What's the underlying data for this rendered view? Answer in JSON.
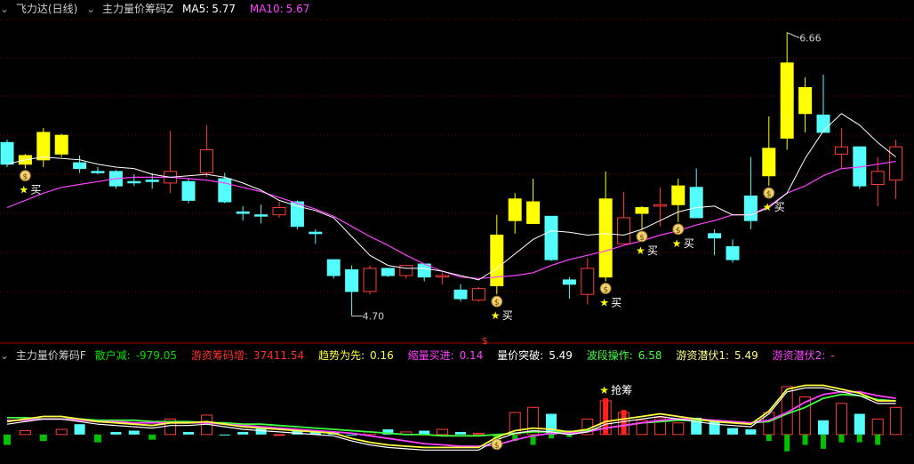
{
  "top_header": {
    "title": "飞力达(日线)",
    "indicator": "主力量价筹码Z",
    "ma5_label": "MA5:",
    "ma5_value": "5.77",
    "ma10_label": "MA10:",
    "ma10_value": "5.67"
  },
  "sub_header": {
    "indicator": "主力量价筹码F",
    "items": [
      {
        "label": "散户减:",
        "value": "-979.05"
      },
      {
        "label": "游资筹码增:",
        "value": "37411.54"
      },
      {
        "label": "趋势为先:",
        "value": "0.16"
      },
      {
        "label": "缩量买进:",
        "value": "0.14"
      },
      {
        "label": "量价突破:",
        "value": "5.49"
      },
      {
        "label": "波段操作:",
        "value": "6.58"
      },
      {
        "label": "游资潜伏1:",
        "value": "5.49"
      },
      {
        "label": "游资潜伏2:",
        "value": "-"
      }
    ]
  },
  "colors": {
    "up": "#ff3c3c",
    "down": "#54fcfc",
    "signal": "#ffff00",
    "ma5": "#ffffff",
    "ma10": "#ff40ff",
    "grid": "#7a0000",
    "header_ma5": "#ffffff",
    "header_ma10": "#ff40ff"
  },
  "annotations": {
    "high_label": "6.66",
    "low_label": "4.70",
    "buy_label": "买",
    "grab_label": "抢筹",
    "dollar": "$"
  },
  "chart_data": [
    {
      "type": "candlestick",
      "ylim": [
        4.55,
        6.75
      ],
      "candles": [
        {
          "o": 5.9,
          "h": 5.92,
          "c": 5.75,
          "l": 5.73,
          "k": "d"
        },
        {
          "o": 5.75,
          "h": 5.82,
          "c": 5.81,
          "l": 5.72,
          "k": "y"
        },
        {
          "o": 5.78,
          "h": 6.0,
          "c": 5.97,
          "l": 5.73,
          "k": "y"
        },
        {
          "o": 5.82,
          "h": 5.96,
          "c": 5.95,
          "l": 5.8,
          "k": "y"
        },
        {
          "o": 5.76,
          "h": 5.81,
          "c": 5.72,
          "l": 5.69,
          "k": "d"
        },
        {
          "o": 5.7,
          "h": 5.73,
          "c": 5.7,
          "l": 5.68,
          "k": "d"
        },
        {
          "o": 5.7,
          "h": 5.71,
          "c": 5.6,
          "l": 5.58,
          "k": "d"
        },
        {
          "o": 5.63,
          "h": 5.68,
          "c": 5.63,
          "l": 5.6,
          "k": "d"
        },
        {
          "o": 5.64,
          "h": 5.69,
          "c": 5.63,
          "l": 5.58,
          "k": "d"
        },
        {
          "o": 5.62,
          "h": 5.98,
          "c": 5.7,
          "l": 5.55,
          "k": "u"
        },
        {
          "o": 5.63,
          "h": 5.65,
          "c": 5.5,
          "l": 5.48,
          "k": "d"
        },
        {
          "o": 5.69,
          "h": 6.02,
          "c": 5.85,
          "l": 5.66,
          "k": "u"
        },
        {
          "o": 5.65,
          "h": 5.69,
          "c": 5.49,
          "l": 5.48,
          "k": "d"
        },
        {
          "o": 5.42,
          "h": 5.46,
          "c": 5.41,
          "l": 5.36,
          "k": "d"
        },
        {
          "o": 5.4,
          "h": 5.47,
          "c": 5.4,
          "l": 5.34,
          "k": "d"
        },
        {
          "o": 5.4,
          "h": 5.49,
          "c": 5.45,
          "l": 5.38,
          "k": "u"
        },
        {
          "o": 5.49,
          "h": 5.5,
          "c": 5.32,
          "l": 5.3,
          "k": "d"
        },
        {
          "o": 5.28,
          "h": 5.3,
          "c": 5.27,
          "l": 5.2,
          "k": "d"
        },
        {
          "o": 5.09,
          "h": 5.09,
          "c": 4.98,
          "l": 4.96,
          "k": "d"
        },
        {
          "o": 5.02,
          "h": 5.05,
          "c": 4.87,
          "l": 4.7,
          "k": "d"
        },
        {
          "o": 4.87,
          "h": 5.05,
          "c": 5.03,
          "l": 4.85,
          "k": "u"
        },
        {
          "o": 5.03,
          "h": 5.03,
          "c": 4.98,
          "l": 4.97,
          "k": "d"
        },
        {
          "o": 4.98,
          "h": 5.05,
          "c": 5.05,
          "l": 4.96,
          "k": "u"
        },
        {
          "o": 5.06,
          "h": 5.06,
          "c": 4.97,
          "l": 4.94,
          "k": "d"
        },
        {
          "o": 4.98,
          "h": 5.0,
          "c": 4.97,
          "l": 4.92,
          "k": "u"
        },
        {
          "o": 4.88,
          "h": 4.92,
          "c": 4.82,
          "l": 4.8,
          "k": "d"
        },
        {
          "o": 4.81,
          "h": 4.9,
          "c": 4.89,
          "l": 4.8,
          "k": "u"
        },
        {
          "o": 4.91,
          "h": 5.4,
          "c": 5.26,
          "l": 4.85,
          "k": "y"
        },
        {
          "o": 5.36,
          "h": 5.55,
          "c": 5.51,
          "l": 5.27,
          "k": "y"
        },
        {
          "o": 5.49,
          "h": 5.65,
          "c": 5.34,
          "l": 5.34,
          "k": "y"
        },
        {
          "o": 5.39,
          "h": 5.39,
          "c": 5.09,
          "l": 5.08,
          "k": "d"
        },
        {
          "o": 4.95,
          "h": 4.97,
          "c": 4.92,
          "l": 4.82,
          "k": "d"
        },
        {
          "o": 4.85,
          "h": 5.1,
          "c": 5.03,
          "l": 4.78,
          "k": "u"
        },
        {
          "o": 4.97,
          "h": 5.7,
          "c": 5.51,
          "l": 4.94,
          "k": "y"
        },
        {
          "o": 5.38,
          "h": 5.56,
          "c": 5.2,
          "l": 5.2,
          "k": "u"
        },
        {
          "o": 5.41,
          "h": 5.46,
          "c": 5.45,
          "l": 5.3,
          "k": "y"
        },
        {
          "o": 5.46,
          "h": 5.59,
          "c": 5.47,
          "l": 5.32,
          "k": "u"
        },
        {
          "o": 5.6,
          "h": 5.65,
          "c": 5.47,
          "l": 5.35,
          "k": "y"
        },
        {
          "o": 5.59,
          "h": 5.72,
          "c": 5.38,
          "l": 5.38,
          "k": "d"
        },
        {
          "o": 5.27,
          "h": 5.3,
          "c": 5.24,
          "l": 5.12,
          "k": "d"
        },
        {
          "o": 5.18,
          "h": 5.23,
          "c": 5.09,
          "l": 5.07,
          "k": "d"
        },
        {
          "o": 5.36,
          "h": 5.8,
          "c": 5.53,
          "l": 5.3,
          "k": "d"
        },
        {
          "o": 5.67,
          "h": 6.08,
          "c": 5.86,
          "l": 5.6,
          "k": "y"
        },
        {
          "o": 5.93,
          "h": 6.66,
          "c": 6.45,
          "l": 5.85,
          "k": "y"
        },
        {
          "o": 6.28,
          "h": 6.35,
          "c": 6.1,
          "l": 5.97,
          "k": "y"
        },
        {
          "o": 6.09,
          "h": 6.37,
          "c": 5.97,
          "l": 5.97,
          "k": "d"
        },
        {
          "o": 5.87,
          "h": 6.0,
          "c": 5.82,
          "l": 5.72,
          "k": "u"
        },
        {
          "o": 5.87,
          "h": 5.87,
          "c": 5.6,
          "l": 5.58,
          "k": "d"
        },
        {
          "o": 5.61,
          "h": 5.8,
          "c": 5.7,
          "l": 5.46,
          "k": "u"
        },
        {
          "o": 5.87,
          "h": 5.92,
          "c": 5.64,
          "l": 5.51,
          "k": "u"
        }
      ],
      "ma5": [
        5.75,
        5.78,
        5.8,
        5.79,
        5.78,
        5.75,
        5.73,
        5.72,
        5.68,
        5.66,
        5.67,
        5.68,
        5.66,
        5.62,
        5.57,
        5.5,
        5.46,
        5.43,
        5.38,
        5.25,
        5.12,
        5.05,
        5.03,
        5.03,
        5.01,
        4.98,
        4.95,
        5.03,
        5.13,
        5.23,
        5.29,
        5.28,
        5.26,
        5.27,
        5.26,
        5.3,
        5.36,
        5.42,
        5.45,
        5.46,
        5.4,
        5.4,
        5.45,
        5.55,
        5.79,
        5.98,
        6.1,
        6.02,
        5.9,
        5.8
      ],
      "ma10": [
        5.45,
        5.5,
        5.55,
        5.59,
        5.61,
        5.63,
        5.65,
        5.66,
        5.66,
        5.66,
        5.65,
        5.64,
        5.62,
        5.59,
        5.56,
        5.52,
        5.48,
        5.44,
        5.39,
        5.32,
        5.25,
        5.19,
        5.12,
        5.06,
        5.01,
        4.97,
        4.96,
        4.97,
        4.98,
        5.0,
        5.05,
        5.09,
        5.12,
        5.15,
        5.19,
        5.22,
        5.26,
        5.29,
        5.33,
        5.36,
        5.4,
        5.4,
        5.46,
        5.55,
        5.6,
        5.67,
        5.72,
        5.73,
        5.75,
        5.77
      ]
    },
    {
      "type": "bar",
      "ylim": [
        -2.0,
        5.0
      ],
      "series": [
        {
          "name": "散户减",
          "values": [
            -0.8,
            0.3,
            -0.5,
            0.4,
            0.8,
            -0.6,
            0.2,
            0.3,
            -0.4,
            1.2,
            0.2,
            1.5,
            0.0,
            0.2,
            0.5,
            0.0,
            0.3,
            0.2,
            0.2,
            0.0,
            0.2,
            0.4,
            0.2,
            0.3,
            0.4,
            0.2,
            0.1,
            -0.6,
            1.7,
            2.1,
            1.6,
            0.3,
            1.2,
            2.6,
            1.7,
            1.1,
            1.3,
            0.9,
            1.3,
            1.0,
            0.5,
            0.4,
            1.7,
            3.7,
            2.9,
            1.1,
            2.4,
            1.6,
            1.2,
            2.1
          ]
        },
        {
          "name": "游资筹码增",
          "values": [
            0,
            0,
            0,
            0,
            0,
            0,
            0,
            0,
            0,
            0,
            0,
            0,
            0,
            0,
            0,
            0,
            0,
            0,
            0,
            0,
            0,
            0,
            0,
            0,
            0,
            0,
            0,
            0,
            -0.5,
            -0.8,
            -0.3,
            -0.2,
            0,
            2.8,
            1.9,
            0,
            0,
            0,
            0,
            0,
            0,
            0,
            -0.5,
            -1.3,
            -0.8,
            -1.1,
            -0.6,
            -0.6,
            -0.8,
            0
          ]
        },
        {
          "name": "趋势为先",
          "values": [
            1.0,
            1.2,
            1.4,
            1.4,
            1.2,
            1.0,
            0.9,
            0.8,
            0.7,
            0.9,
            0.9,
            1.0,
            0.8,
            0.6,
            0.5,
            0.4,
            0.3,
            0.2,
            0.1,
            -0.3,
            -0.6,
            -0.8,
            -0.9,
            -1.0,
            -1.0,
            -1.0,
            -1.0,
            -0.2,
            0.3,
            0.5,
            0.4,
            0.2,
            0.4,
            1.0,
            1.2,
            1.4,
            1.6,
            1.4,
            1.2,
            1.0,
            0.9,
            0.8,
            1.8,
            3.5,
            3.8,
            3.8,
            3.5,
            3.2,
            2.6,
            2.6
          ]
        },
        {
          "name": "缩量买进",
          "values": [
            1.1,
            1.1,
            1.2,
            1.2,
            1.1,
            1.0,
            1.0,
            0.9,
            0.9,
            0.9,
            0.9,
            0.9,
            0.8,
            0.7,
            0.6,
            0.5,
            0.4,
            0.3,
            0.2,
            0.1,
            -0.1,
            -0.3,
            -0.5,
            -0.7,
            -0.8,
            -0.9,
            -0.9,
            -0.8,
            -0.4,
            -0.1,
            0.1,
            0.1,
            0.2,
            0.5,
            0.7,
            0.9,
            1.1,
            1.2,
            1.2,
            1.1,
            1.0,
            0.9,
            1.1,
            1.7,
            2.5,
            3.1,
            3.3,
            3.3,
            3.0,
            2.8
          ]
        },
        {
          "name": "量价突破",
          "values": [
            1.3,
            1.3,
            1.2,
            1.2,
            1.2,
            1.1,
            1.1,
            1.1,
            1.0,
            1.0,
            1.0,
            0.9,
            0.9,
            0.8,
            0.8,
            0.7,
            0.6,
            0.5,
            0.4,
            0.3,
            0.2,
            0.1,
            0.0,
            0.0,
            -0.1,
            -0.1,
            -0.1,
            0.0,
            0.1,
            0.2,
            0.2,
            0.2,
            0.3,
            0.5,
            0.7,
            0.9,
            1.0,
            1.1,
            1.1,
            1.1,
            1.0,
            0.9,
            1.0,
            1.6,
            2.1,
            2.8,
            3.1,
            3.0,
            2.7,
            2.6
          ]
        }
      ]
    }
  ],
  "signals": {
    "buy": [
      1,
      27,
      33,
      35,
      37,
      42
    ],
    "money_bag": [
      1,
      27,
      33,
      35,
      37,
      42
    ],
    "sub_money_bag": [
      27
    ],
    "grab": [
      33
    ],
    "high_index": 43,
    "low_index": 19
  }
}
